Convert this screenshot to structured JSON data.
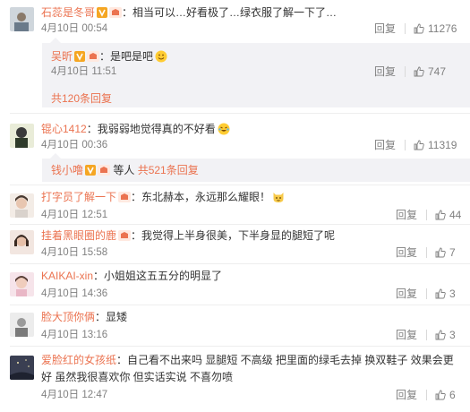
{
  "comments": [
    {
      "user": "石蕊是冬哥",
      "text": "：相当可以…好看极了…绿衣服了解一下了…",
      "time": "4月10日 00:54",
      "reply": "回复",
      "likes": "11276",
      "reply_thread": {
        "user": "吴昕",
        "text": "：是吧是吧",
        "time": "4月10日 11:51",
        "reply": "回复",
        "likes": "747",
        "total": "共120条回复"
      }
    },
    {
      "user": "锟心1412",
      "text": "：我弱弱地觉得真的不好看",
      "time": "4月10日 00:36",
      "reply": "回复",
      "likes": "11319",
      "sub_line": {
        "user": "钱小噜",
        "mid": " 等人 ",
        "total": "共521条回复"
      }
    },
    {
      "user": "打字员了解一下",
      "text": "：东北赫本，永远那么耀眼！",
      "time": "4月10日 12:51",
      "reply": "回复",
      "likes": "44"
    },
    {
      "user": "挂着黑眼圈的鹿",
      "text": "：我觉得上半身很美，下半身显的腿短了呢",
      "time": "4月10日 15:58",
      "reply": "回复",
      "likes": "7"
    },
    {
      "user": "KAIKAI-xin",
      "text": "：小姐姐这五五分的明显了",
      "time": "4月10日 14:36",
      "reply": "回复",
      "likes": "3"
    },
    {
      "user": "脸大顶你俩",
      "text": "：显矮",
      "time": "4月10日 13:16",
      "reply": "回复",
      "likes": "3"
    },
    {
      "user": "爱脸红的女孩纸",
      "text": "：自己看不出来吗 显腿短 不高级 把里面的绿毛去掉 换双鞋子 效果会更",
      "text2": "好 虽然我很喜欢你 但实话实说  不喜勿喷",
      "time": "4月10日 12:47",
      "reply": "回复",
      "likes": "6"
    }
  ],
  "colors": {
    "accent": "#eb7350",
    "muted": "#808080",
    "subbox": "#f2f2f5"
  }
}
